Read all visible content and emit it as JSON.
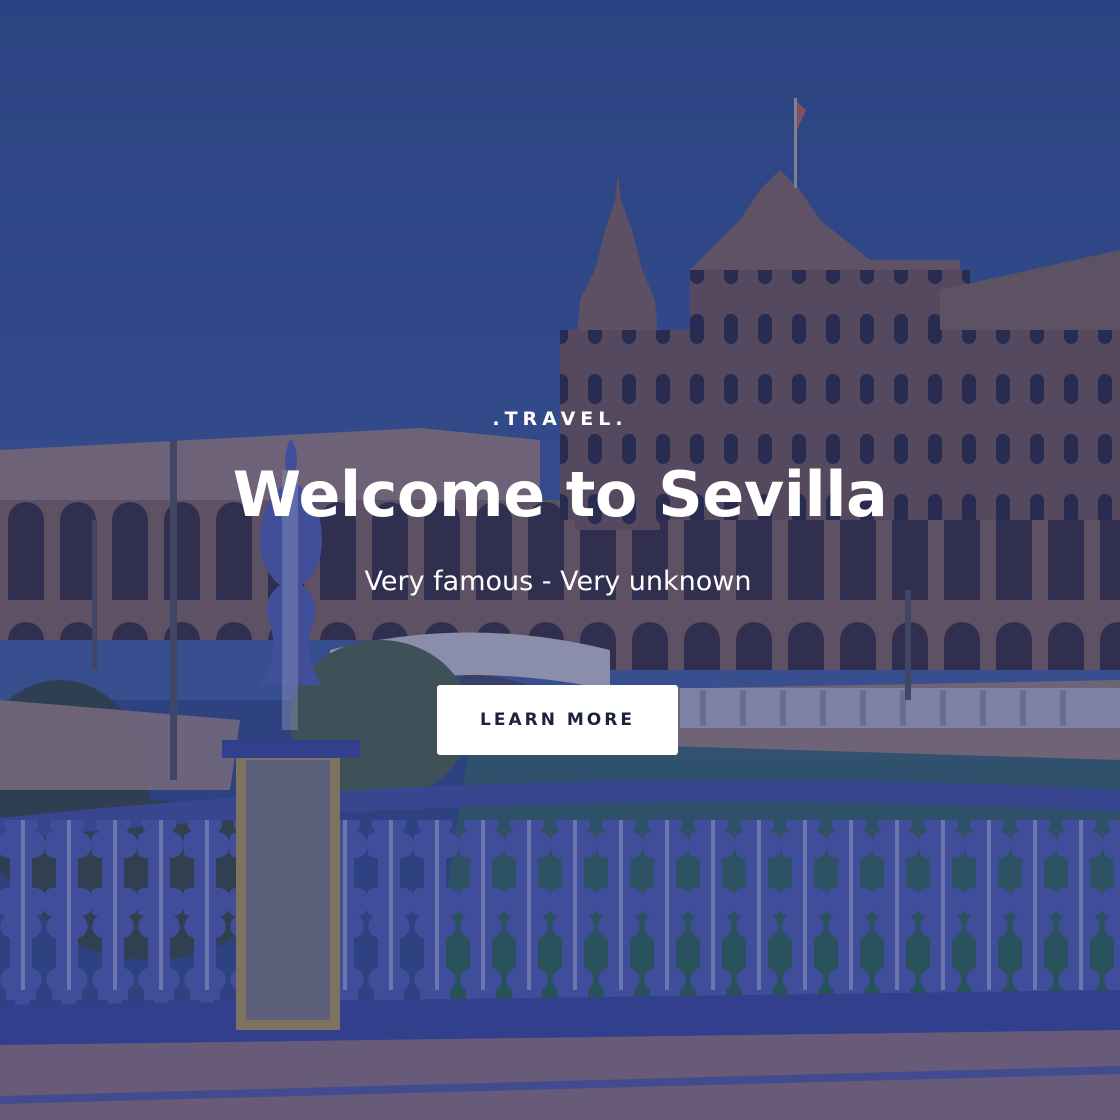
{
  "hero": {
    "eyebrow": ".TRAVEL.",
    "title": "Welcome to Sevilla",
    "subtitle": "Very famous - Very unknown",
    "cta_label": "LEARN MORE"
  },
  "colors": {
    "overlay": "#1f3070",
    "sky": "#3b5598",
    "text": "#ffffff",
    "button_bg": "#ffffff",
    "button_text": "#1b2240"
  }
}
